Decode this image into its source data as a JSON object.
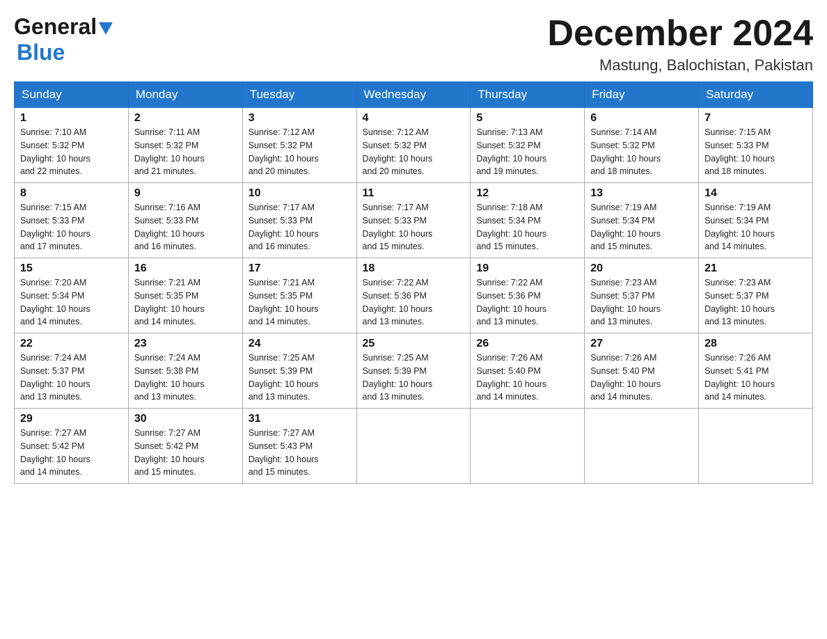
{
  "header": {
    "logo_general": "General",
    "logo_blue": "Blue",
    "title": "December 2024",
    "subtitle": "Mastung, Balochistan, Pakistan"
  },
  "days_of_week": [
    "Sunday",
    "Monday",
    "Tuesday",
    "Wednesday",
    "Thursday",
    "Friday",
    "Saturday"
  ],
  "weeks": [
    [
      {
        "day": "1",
        "sunrise": "7:10 AM",
        "sunset": "5:32 PM",
        "daylight": "10 hours and 22 minutes."
      },
      {
        "day": "2",
        "sunrise": "7:11 AM",
        "sunset": "5:32 PM",
        "daylight": "10 hours and 21 minutes."
      },
      {
        "day": "3",
        "sunrise": "7:12 AM",
        "sunset": "5:32 PM",
        "daylight": "10 hours and 20 minutes."
      },
      {
        "day": "4",
        "sunrise": "7:12 AM",
        "sunset": "5:32 PM",
        "daylight": "10 hours and 20 minutes."
      },
      {
        "day": "5",
        "sunrise": "7:13 AM",
        "sunset": "5:32 PM",
        "daylight": "10 hours and 19 minutes."
      },
      {
        "day": "6",
        "sunrise": "7:14 AM",
        "sunset": "5:32 PM",
        "daylight": "10 hours and 18 minutes."
      },
      {
        "day": "7",
        "sunrise": "7:15 AM",
        "sunset": "5:33 PM",
        "daylight": "10 hours and 18 minutes."
      }
    ],
    [
      {
        "day": "8",
        "sunrise": "7:15 AM",
        "sunset": "5:33 PM",
        "daylight": "10 hours and 17 minutes."
      },
      {
        "day": "9",
        "sunrise": "7:16 AM",
        "sunset": "5:33 PM",
        "daylight": "10 hours and 16 minutes."
      },
      {
        "day": "10",
        "sunrise": "7:17 AM",
        "sunset": "5:33 PM",
        "daylight": "10 hours and 16 minutes."
      },
      {
        "day": "11",
        "sunrise": "7:17 AM",
        "sunset": "5:33 PM",
        "daylight": "10 hours and 15 minutes."
      },
      {
        "day": "12",
        "sunrise": "7:18 AM",
        "sunset": "5:34 PM",
        "daylight": "10 hours and 15 minutes."
      },
      {
        "day": "13",
        "sunrise": "7:19 AM",
        "sunset": "5:34 PM",
        "daylight": "10 hours and 15 minutes."
      },
      {
        "day": "14",
        "sunrise": "7:19 AM",
        "sunset": "5:34 PM",
        "daylight": "10 hours and 14 minutes."
      }
    ],
    [
      {
        "day": "15",
        "sunrise": "7:20 AM",
        "sunset": "5:34 PM",
        "daylight": "10 hours and 14 minutes."
      },
      {
        "day": "16",
        "sunrise": "7:21 AM",
        "sunset": "5:35 PM",
        "daylight": "10 hours and 14 minutes."
      },
      {
        "day": "17",
        "sunrise": "7:21 AM",
        "sunset": "5:35 PM",
        "daylight": "10 hours and 14 minutes."
      },
      {
        "day": "18",
        "sunrise": "7:22 AM",
        "sunset": "5:36 PM",
        "daylight": "10 hours and 13 minutes."
      },
      {
        "day": "19",
        "sunrise": "7:22 AM",
        "sunset": "5:36 PM",
        "daylight": "10 hours and 13 minutes."
      },
      {
        "day": "20",
        "sunrise": "7:23 AM",
        "sunset": "5:37 PM",
        "daylight": "10 hours and 13 minutes."
      },
      {
        "day": "21",
        "sunrise": "7:23 AM",
        "sunset": "5:37 PM",
        "daylight": "10 hours and 13 minutes."
      }
    ],
    [
      {
        "day": "22",
        "sunrise": "7:24 AM",
        "sunset": "5:37 PM",
        "daylight": "10 hours and 13 minutes."
      },
      {
        "day": "23",
        "sunrise": "7:24 AM",
        "sunset": "5:38 PM",
        "daylight": "10 hours and 13 minutes."
      },
      {
        "day": "24",
        "sunrise": "7:25 AM",
        "sunset": "5:39 PM",
        "daylight": "10 hours and 13 minutes."
      },
      {
        "day": "25",
        "sunrise": "7:25 AM",
        "sunset": "5:39 PM",
        "daylight": "10 hours and 13 minutes."
      },
      {
        "day": "26",
        "sunrise": "7:26 AM",
        "sunset": "5:40 PM",
        "daylight": "10 hours and 14 minutes."
      },
      {
        "day": "27",
        "sunrise": "7:26 AM",
        "sunset": "5:40 PM",
        "daylight": "10 hours and 14 minutes."
      },
      {
        "day": "28",
        "sunrise": "7:26 AM",
        "sunset": "5:41 PM",
        "daylight": "10 hours and 14 minutes."
      }
    ],
    [
      {
        "day": "29",
        "sunrise": "7:27 AM",
        "sunset": "5:42 PM",
        "daylight": "10 hours and 14 minutes."
      },
      {
        "day": "30",
        "sunrise": "7:27 AM",
        "sunset": "5:42 PM",
        "daylight": "10 hours and 15 minutes."
      },
      {
        "day": "31",
        "sunrise": "7:27 AM",
        "sunset": "5:43 PM",
        "daylight": "10 hours and 15 minutes."
      },
      null,
      null,
      null,
      null
    ]
  ],
  "labels": {
    "sunrise": "Sunrise:",
    "sunset": "Sunset:",
    "daylight": "Daylight:"
  }
}
